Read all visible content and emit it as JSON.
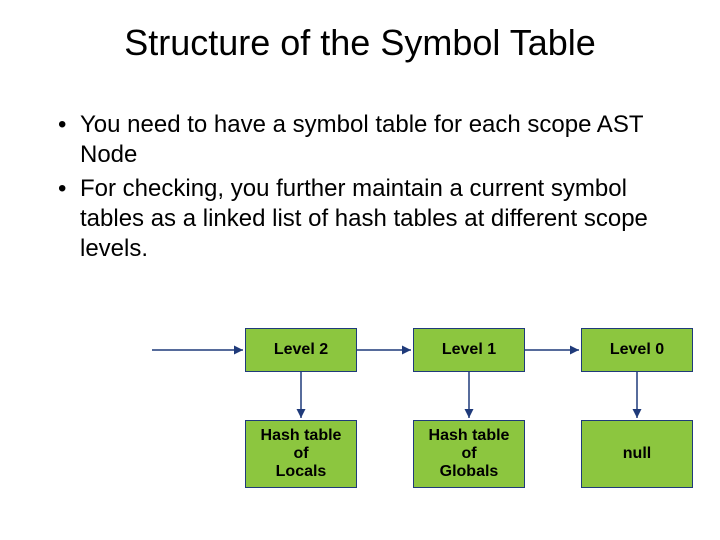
{
  "title": "Structure of the Symbol Table",
  "bullets": [
    "You need to have a symbol table for each scope AST Node",
    "For checking, you further maintain a current symbol tables as a linked list of hash tables at different scope levels."
  ],
  "boxes": {
    "top": [
      {
        "label": "Level 2"
      },
      {
        "label": "Level 1"
      },
      {
        "label": "Level 0"
      }
    ],
    "bottom": [
      {
        "label": "Hash table\nof\nLocals"
      },
      {
        "label": "Hash table\nof\nGlobals"
      },
      {
        "label": "null"
      }
    ]
  }
}
